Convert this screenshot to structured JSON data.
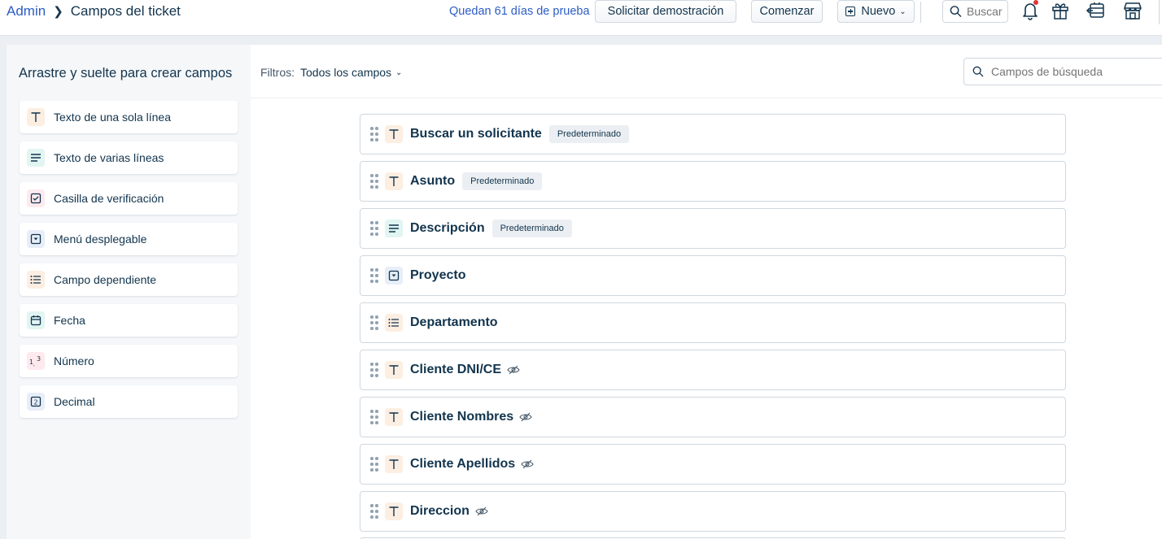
{
  "header": {
    "breadcrumb_root": "Admin",
    "breadcrumb_current": "Campos del ticket",
    "trial_text": "Quedan 61 días de prueba",
    "demo_button": "Solicitar demostración",
    "start_button": "Comenzar",
    "new_button": "Nuevo",
    "search_placeholder": "Buscar"
  },
  "sidebar": {
    "heading": "Arrastre y suelte para crear campos",
    "items": [
      {
        "label": "Texto de una sola línea",
        "icon": "single-line-text-icon"
      },
      {
        "label": "Texto de varias líneas",
        "icon": "multi-line-text-icon"
      },
      {
        "label": "Casilla de verificación",
        "icon": "checkbox-icon"
      },
      {
        "label": "Menú desplegable",
        "icon": "dropdown-icon"
      },
      {
        "label": "Campo dependiente",
        "icon": "dependent-field-icon"
      },
      {
        "label": "Fecha",
        "icon": "calendar-icon"
      },
      {
        "label": "Número",
        "icon": "number-icon"
      },
      {
        "label": "Decimal",
        "icon": "decimal-icon"
      }
    ]
  },
  "filters": {
    "label": "Filtros:",
    "value": "Todos los campos",
    "search_placeholder": "Campos de búsqueda"
  },
  "fields": [
    {
      "name": "Buscar un solicitante",
      "type": "text",
      "badge": "Predeterminado",
      "hidden": false
    },
    {
      "name": "Asunto",
      "type": "text",
      "badge": "Predeterminado",
      "hidden": false
    },
    {
      "name": "Descripción",
      "type": "paragraph",
      "badge": "Predeterminado",
      "hidden": false
    },
    {
      "name": "Proyecto",
      "type": "dropdown",
      "badge": "",
      "hidden": false
    },
    {
      "name": "Departamento",
      "type": "dependent",
      "badge": "",
      "hidden": false
    },
    {
      "name": "Cliente DNI/CE",
      "type": "text",
      "badge": "",
      "hidden": true
    },
    {
      "name": "Cliente Nombres",
      "type": "text",
      "badge": "",
      "hidden": true
    },
    {
      "name": "Cliente Apellidos",
      "type": "text",
      "badge": "",
      "hidden": true
    },
    {
      "name": "Direccion",
      "type": "text",
      "badge": "",
      "hidden": true
    }
  ],
  "colors": {
    "link": "#2c5cc5",
    "text": "#12344d",
    "notification_dot": "#e43538",
    "icon_text_bg": "#fdeee2",
    "icon_para_bg": "#e1f5f3"
  }
}
